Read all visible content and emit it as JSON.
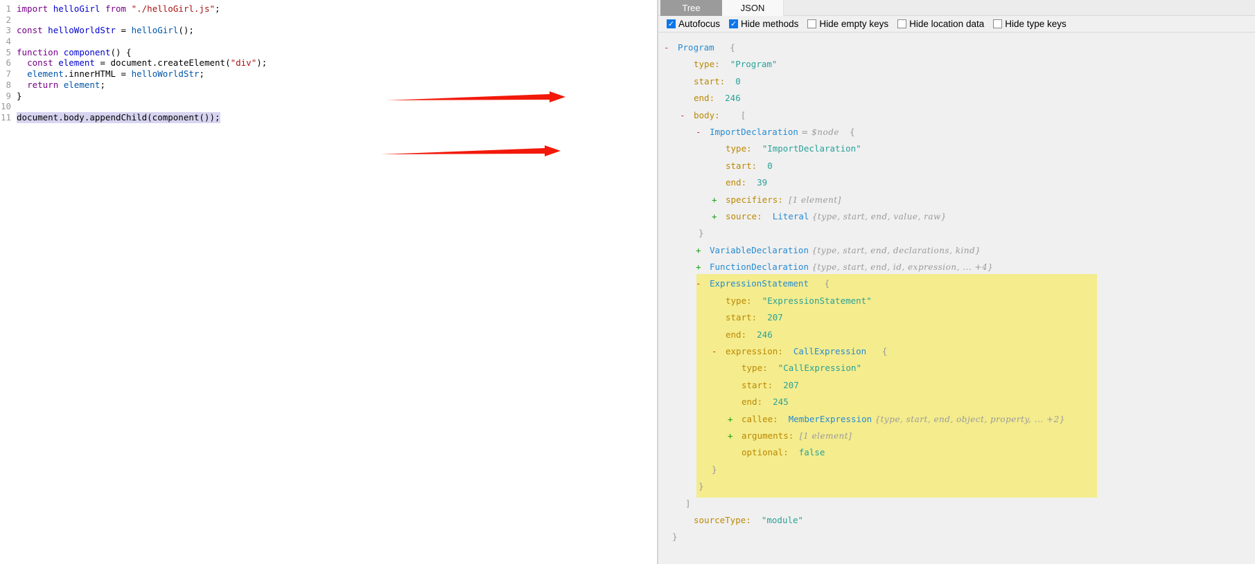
{
  "editor": {
    "lines": [
      {
        "num": "1",
        "selected": false,
        "tokens": [
          {
            "c": "k",
            "t": "import"
          },
          {
            "c": "p",
            "t": " "
          },
          {
            "c": "d",
            "t": "helloGirl"
          },
          {
            "c": "p",
            "t": " "
          },
          {
            "c": "k",
            "t": "from"
          },
          {
            "c": "p",
            "t": " "
          },
          {
            "c": "s",
            "t": "\"./helloGirl.js\""
          },
          {
            "c": "p",
            "t": ";"
          }
        ]
      },
      {
        "num": "2",
        "selected": false,
        "tokens": []
      },
      {
        "num": "3",
        "selected": false,
        "tokens": [
          {
            "c": "k",
            "t": "const"
          },
          {
            "c": "p",
            "t": " "
          },
          {
            "c": "d",
            "t": "helloWorldStr"
          },
          {
            "c": "p",
            "t": " = "
          },
          {
            "c": "v",
            "t": "helloGirl"
          },
          {
            "c": "p",
            "t": "();"
          }
        ]
      },
      {
        "num": "4",
        "selected": false,
        "tokens": []
      },
      {
        "num": "5",
        "selected": false,
        "tokens": [
          {
            "c": "k",
            "t": "function"
          },
          {
            "c": "p",
            "t": " "
          },
          {
            "c": "d",
            "t": "component"
          },
          {
            "c": "p",
            "t": "() {"
          }
        ]
      },
      {
        "num": "6",
        "selected": false,
        "tokens": [
          {
            "c": "p",
            "t": "  "
          },
          {
            "c": "k",
            "t": "const"
          },
          {
            "c": "p",
            "t": " "
          },
          {
            "c": "d",
            "t": "element"
          },
          {
            "c": "p",
            "t": " = document.createElement("
          },
          {
            "c": "s",
            "t": "\"div\""
          },
          {
            "c": "p",
            "t": ");"
          }
        ]
      },
      {
        "num": "7",
        "selected": false,
        "tokens": [
          {
            "c": "p",
            "t": "  "
          },
          {
            "c": "v",
            "t": "element"
          },
          {
            "c": "p",
            "t": ".innerHTML = "
          },
          {
            "c": "v",
            "t": "helloWorldStr"
          },
          {
            "c": "p",
            "t": ";"
          }
        ]
      },
      {
        "num": "8",
        "selected": false,
        "tokens": [
          {
            "c": "p",
            "t": "  "
          },
          {
            "c": "k",
            "t": "return"
          },
          {
            "c": "p",
            "t": " "
          },
          {
            "c": "v",
            "t": "element"
          },
          {
            "c": "p",
            "t": ";"
          }
        ]
      },
      {
        "num": "9",
        "selected": false,
        "tokens": [
          {
            "c": "p",
            "t": "}"
          }
        ]
      },
      {
        "num": "10",
        "selected": false,
        "tokens": []
      },
      {
        "num": "11",
        "selected": true,
        "tokens": [
          {
            "c": "p",
            "t": "document.body.appendChild(component());"
          }
        ]
      }
    ]
  },
  "annotations": {
    "arrow_color": "#f2190a",
    "count": 2
  },
  "panel": {
    "tabs": [
      {
        "label": "Tree",
        "active": true
      },
      {
        "label": "JSON",
        "active": false
      }
    ],
    "checkboxes": [
      {
        "label": "Autofocus",
        "checked": true
      },
      {
        "label": "Hide methods",
        "checked": true
      },
      {
        "label": "Hide empty keys",
        "checked": false
      },
      {
        "label": "Hide location data",
        "checked": false
      },
      {
        "label": "Hide type keys",
        "checked": false
      }
    ]
  },
  "tree": {
    "highlight_color": "#f4ec8d",
    "rows": [
      {
        "lvl": 0,
        "sign": "-",
        "hl": false,
        "closer": false,
        "parts": [
          {
            "c": "n",
            "t": "Program"
          },
          {
            "c": "pu",
            "t": "   {"
          }
        ]
      },
      {
        "lvl": 1,
        "sign": "",
        "hl": false,
        "closer": false,
        "parts": [
          {
            "c": "k",
            "t": "type:"
          },
          {
            "c": "val",
            "t": "  \"Program\""
          }
        ]
      },
      {
        "lvl": 1,
        "sign": "",
        "hl": false,
        "closer": false,
        "parts": [
          {
            "c": "k",
            "t": "start:"
          },
          {
            "c": "val",
            "t": "  0"
          }
        ]
      },
      {
        "lvl": 1,
        "sign": "",
        "hl": false,
        "closer": false,
        "parts": [
          {
            "c": "k",
            "t": "end:"
          },
          {
            "c": "val",
            "t": "  246"
          }
        ]
      },
      {
        "lvl": 1,
        "sign": "-",
        "hl": false,
        "closer": false,
        "parts": [
          {
            "c": "k",
            "t": "body:"
          },
          {
            "c": "pu",
            "t": "    ["
          }
        ]
      },
      {
        "lvl": 2,
        "sign": "-",
        "hl": false,
        "closer": false,
        "parts": [
          {
            "c": "n",
            "t": "ImportDeclaration"
          },
          {
            "c": "pv",
            "t": " = $node"
          },
          {
            "c": "pu",
            "t": "  {"
          }
        ]
      },
      {
        "lvl": 3,
        "sign": "",
        "hl": false,
        "closer": false,
        "parts": [
          {
            "c": "k",
            "t": "type:"
          },
          {
            "c": "val",
            "t": "  \"ImportDeclaration\""
          }
        ]
      },
      {
        "lvl": 3,
        "sign": "",
        "hl": false,
        "closer": false,
        "parts": [
          {
            "c": "k",
            "t": "start:"
          },
          {
            "c": "val",
            "t": "  0"
          }
        ]
      },
      {
        "lvl": 3,
        "sign": "",
        "hl": false,
        "closer": false,
        "parts": [
          {
            "c": "k",
            "t": "end:"
          },
          {
            "c": "val",
            "t": "  39"
          }
        ]
      },
      {
        "lvl": 3,
        "sign": "+",
        "hl": false,
        "closer": false,
        "parts": [
          {
            "c": "k",
            "t": "specifiers:"
          },
          {
            "c": "pv",
            "t": "  [1 element]"
          }
        ]
      },
      {
        "lvl": 3,
        "sign": "+",
        "hl": false,
        "closer": false,
        "parts": [
          {
            "c": "k",
            "t": "source:"
          },
          {
            "c": "n",
            "t": "  Literal"
          },
          {
            "c": "pv",
            "t": " {type, start, end, value, raw}"
          }
        ]
      },
      {
        "lvl": 2,
        "sign": "",
        "hl": false,
        "closer": true,
        "parts": [
          {
            "c": "pu",
            "t": "}"
          }
        ]
      },
      {
        "lvl": 2,
        "sign": "+",
        "hl": false,
        "closer": false,
        "parts": [
          {
            "c": "n",
            "t": "VariableDeclaration"
          },
          {
            "c": "pv",
            "t": " {type, start, end, declarations, kind}"
          }
        ]
      },
      {
        "lvl": 2,
        "sign": "+",
        "hl": false,
        "closer": false,
        "parts": [
          {
            "c": "n",
            "t": "FunctionDeclaration"
          },
          {
            "c": "pv",
            "t": " {type, start, end, id, expression, ... +4}"
          }
        ]
      },
      {
        "lvl": 2,
        "sign": "-",
        "hl": true,
        "closer": false,
        "parts": [
          {
            "c": "n",
            "t": "ExpressionStatement"
          },
          {
            "c": "pu",
            "t": "   {"
          }
        ]
      },
      {
        "lvl": 3,
        "sign": "",
        "hl": true,
        "closer": false,
        "parts": [
          {
            "c": "k",
            "t": "type:"
          },
          {
            "c": "val",
            "t": "  \"ExpressionStatement\""
          }
        ]
      },
      {
        "lvl": 3,
        "sign": "",
        "hl": true,
        "closer": false,
        "parts": [
          {
            "c": "k",
            "t": "start:"
          },
          {
            "c": "val",
            "t": "  207"
          }
        ]
      },
      {
        "lvl": 3,
        "sign": "",
        "hl": true,
        "closer": false,
        "parts": [
          {
            "c": "k",
            "t": "end:"
          },
          {
            "c": "val",
            "t": "  246"
          }
        ]
      },
      {
        "lvl": 3,
        "sign": "-",
        "hl": true,
        "closer": false,
        "parts": [
          {
            "c": "k",
            "t": "expression:"
          },
          {
            "c": "n",
            "t": "  CallExpression"
          },
          {
            "c": "pu",
            "t": "   {"
          }
        ]
      },
      {
        "lvl": 4,
        "sign": "",
        "hl": true,
        "closer": false,
        "parts": [
          {
            "c": "k",
            "t": "type:"
          },
          {
            "c": "val",
            "t": "  \"CallExpression\""
          }
        ]
      },
      {
        "lvl": 4,
        "sign": "",
        "hl": true,
        "closer": false,
        "parts": [
          {
            "c": "k",
            "t": "start:"
          },
          {
            "c": "val",
            "t": "  207"
          }
        ]
      },
      {
        "lvl": 4,
        "sign": "",
        "hl": true,
        "closer": false,
        "parts": [
          {
            "c": "k",
            "t": "end:"
          },
          {
            "c": "val",
            "t": "  245"
          }
        ]
      },
      {
        "lvl": 4,
        "sign": "+",
        "hl": true,
        "closer": false,
        "parts": [
          {
            "c": "k",
            "t": "callee:"
          },
          {
            "c": "n",
            "t": "  MemberExpression"
          },
          {
            "c": "pv",
            "t": " {type, start, end, object, property, ... +2}"
          }
        ]
      },
      {
        "lvl": 4,
        "sign": "+",
        "hl": true,
        "closer": false,
        "parts": [
          {
            "c": "k",
            "t": "arguments:"
          },
          {
            "c": "pv",
            "t": "  [1 element]"
          }
        ]
      },
      {
        "lvl": 4,
        "sign": "",
        "hl": true,
        "closer": false,
        "parts": [
          {
            "c": "k",
            "t": "optional:"
          },
          {
            "c": "val",
            "t": "  false"
          }
        ]
      },
      {
        "lvl": 3,
        "sign": "",
        "hl": true,
        "closer": true,
        "parts": [
          {
            "c": "pu",
            "t": "}"
          }
        ]
      },
      {
        "lvl": 2,
        "sign": "",
        "hl": true,
        "closer": true,
        "parts": [
          {
            "c": "pu",
            "t": "}"
          }
        ]
      },
      {
        "lvl": 1,
        "sign": "",
        "hl": false,
        "closer": true,
        "parts": [
          {
            "c": "pu",
            "t": "]"
          }
        ]
      },
      {
        "lvl": 1,
        "sign": "",
        "hl": false,
        "closer": false,
        "parts": [
          {
            "c": "k",
            "t": "sourceType:"
          },
          {
            "c": "val",
            "t": "  \"module\""
          }
        ]
      },
      {
        "lvl": 0,
        "sign": "",
        "hl": false,
        "closer": true,
        "parts": [
          {
            "c": "pu",
            "t": "}"
          }
        ]
      }
    ]
  }
}
